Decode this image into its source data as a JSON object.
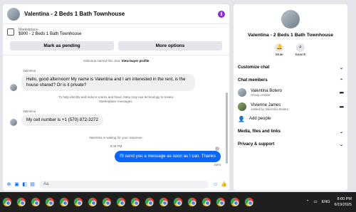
{
  "header": {
    "title": "Valentina - 2 Beds 1 Bath Townhouse",
    "info_icon": "i"
  },
  "marketplace": {
    "label": "Marketplace",
    "listing": "$900 - 2 Beds 1 Bath Townhouse"
  },
  "actions": {
    "mark_pending": "Mark as pending",
    "more_options": "More options"
  },
  "messages": {
    "started": "Valentina started this chat.",
    "view_profile": "View buyer profile",
    "sender_1": "Valentina",
    "msg_1": "Hello, good afternoon! My name is Valentina and I am interested in the rent, is the house shared? Or is it private?",
    "safety": "To help identify and reduce scams and fraud, Meta may use technology to review Marketplace messages.",
    "sender_2": "Valentina",
    "msg_2": "My cell number is +1 (570) 872-3272",
    "waiting": "Valentina is waiting for your response.",
    "time": "8:00 PM",
    "msg_3": "I'll send you a message as soon as I can. Thanks",
    "sent": "Sent"
  },
  "composer": {
    "placeholder": "Aa"
  },
  "sidebar": {
    "title": "Valentina - 2 Beds 1 Bath Townhouse",
    "mute": "Mute",
    "search": "Search",
    "customize": "Customize chat",
    "members_header": "Chat members",
    "member_1_name": "Valentina Botero",
    "member_1_role": "Group creator",
    "member_2_name": "Vivienne James",
    "member_2_role": "Added by Valentina Botero",
    "add_people": "Add people",
    "media": "Media, files and links",
    "privacy": "Privacy & support"
  },
  "taskbar": {
    "lang": "ENG",
    "time": "8:00 PM",
    "date": "6/19/2025"
  },
  "colors": {
    "accent": "#0866ff",
    "info": "#8b2fc9"
  }
}
